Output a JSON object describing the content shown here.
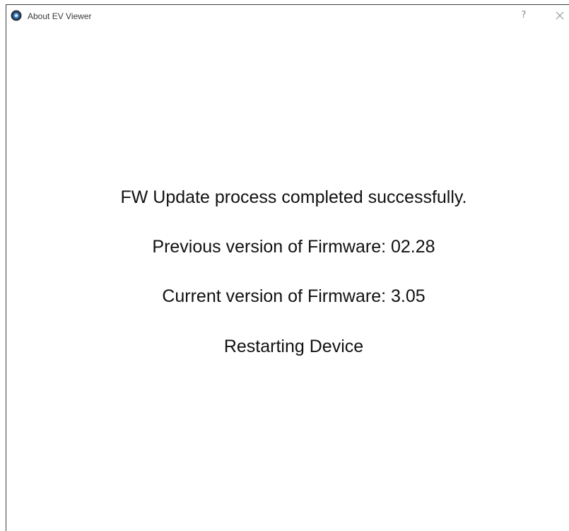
{
  "window": {
    "title": "About EV Viewer",
    "help_label": "?",
    "close_icon": "close-icon",
    "app_icon": "ev-viewer-app-icon"
  },
  "message": {
    "status": "FW Update process completed successfully.",
    "previous_version": "Previous version of Firmware: 02.28",
    "current_version": "Current version of Firmware: 3.05",
    "action": "Restarting Device"
  },
  "colors": {
    "background": "#ffffff",
    "text": "#111111",
    "title_text": "#3a3a3a",
    "window_border": "#3c3c3c",
    "icon_blue": "#1f4f8c"
  }
}
